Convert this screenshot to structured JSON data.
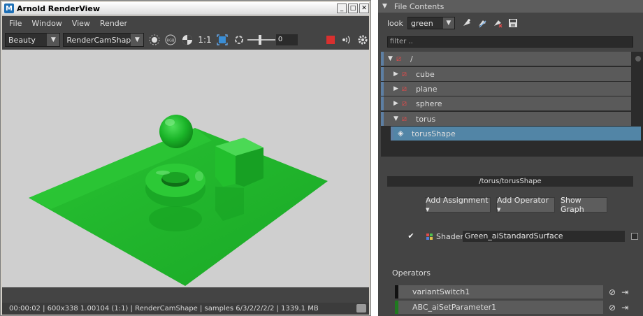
{
  "renderview": {
    "title": "Arnold RenderView",
    "logo": "M",
    "window_controls": [
      "_",
      "□",
      "✕"
    ],
    "menus": [
      "File",
      "Window",
      "View",
      "Render"
    ],
    "toolbar": {
      "aov": "Beauty",
      "camera": "RenderCamShape",
      "ratio_label": "1:1",
      "exposure_value": "0",
      "icons": [
        "sun-icon",
        "rgb-icon",
        "channel-icon",
        "ratio-label",
        "crop-region-icon",
        "refresh-icon",
        "exposure-slider",
        "stop-render-icon",
        "speaker-icon",
        "gear-icon"
      ]
    },
    "status": "00:00:02 | 600x338 1.00104 (1:1) | RenderCamShape | samples 6/3/2/2/2/2 | 1339.1 MB",
    "colors": {
      "stop": "#d9302f",
      "green_material": "#1fbf2a",
      "background": "#cfcfcf"
    }
  },
  "file_contents": {
    "header": "File Contents",
    "look_label": "look",
    "look_value": "green",
    "filter_placeholder": "filter ..",
    "tree": [
      {
        "label": "/",
        "expanded": true,
        "depth": 0
      },
      {
        "label": "cube",
        "expanded": false,
        "depth": 1
      },
      {
        "label": "plane",
        "expanded": false,
        "depth": 1
      },
      {
        "label": "sphere",
        "expanded": false,
        "depth": 1
      },
      {
        "label": "torus",
        "expanded": true,
        "depth": 1
      },
      {
        "label": "torusShape",
        "depth": 2,
        "selected": true
      }
    ],
    "path": "/torus/torusShape",
    "buttons": {
      "add_assignment": "Add Assignment ▾",
      "add_operator": "Add Operator ▾",
      "show_graph": "Show Graph"
    },
    "shader_label": "Shader",
    "shader_value": "Green_aiStandardSurface",
    "operators_label": "Operators",
    "operators": [
      {
        "name": "variantSwitch1",
        "color": "#111111"
      },
      {
        "name": "ABC_aiSetParameter1",
        "color": "#1f7a1f"
      }
    ]
  }
}
